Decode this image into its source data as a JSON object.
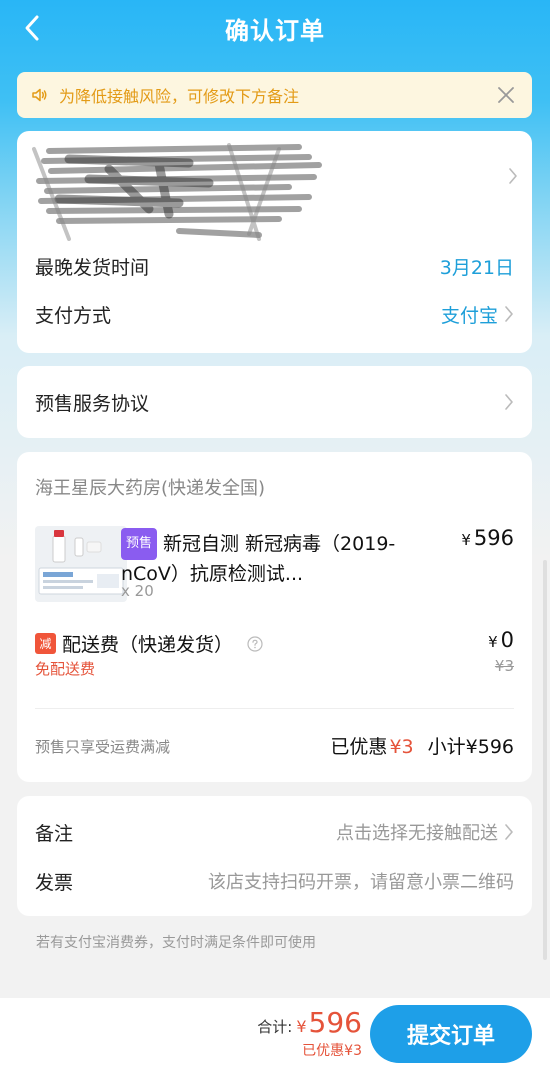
{
  "header": {
    "title": "确认订单"
  },
  "notice": {
    "text": "为降低接触风险，可修改下方备注"
  },
  "order": {
    "latest_ship_label": "最晚发货时间",
    "latest_ship_value": "3月21日",
    "payment_label": "支付方式",
    "payment_value": "支付宝"
  },
  "agreement": {
    "label": "预售服务协议"
  },
  "shop": {
    "name": "海王星辰大药房(快递发全国)",
    "product": {
      "tag": "预售",
      "title": "新冠自测  新冠病毒（2019-nCoV）抗原检测试...",
      "qty": "x 20",
      "yen": "¥",
      "price": "596"
    },
    "shipping": {
      "tag": "减",
      "label": "配送费（快递发货）",
      "free_text": "免配送费",
      "yen": "¥",
      "price": "0",
      "original": "¥3"
    },
    "presale_note": "预售只享受运费满减",
    "discount_label": "已优惠",
    "discount_value": "¥3",
    "subtotal_label": "小计",
    "subtotal_value": "¥596"
  },
  "extras": {
    "note_label": "备注",
    "note_value": "点击选择无接触配送",
    "invoice_label": "发票",
    "invoice_value": "该店支持扫码开票，请留意小票二维码"
  },
  "footer_tip": "若有支付宝消费券，支付时满足条件即可使用",
  "bottom": {
    "total_label": "合计:",
    "total_yen": "¥",
    "total_amount": "596",
    "total_discount": "已优惠¥3",
    "submit_label": "提交订单"
  },
  "colors": {
    "brand_blue": "#1e9fd9",
    "price_red": "#e5533a",
    "presale_purple": "#8a5cf0",
    "notice_orange": "#e39b17"
  }
}
